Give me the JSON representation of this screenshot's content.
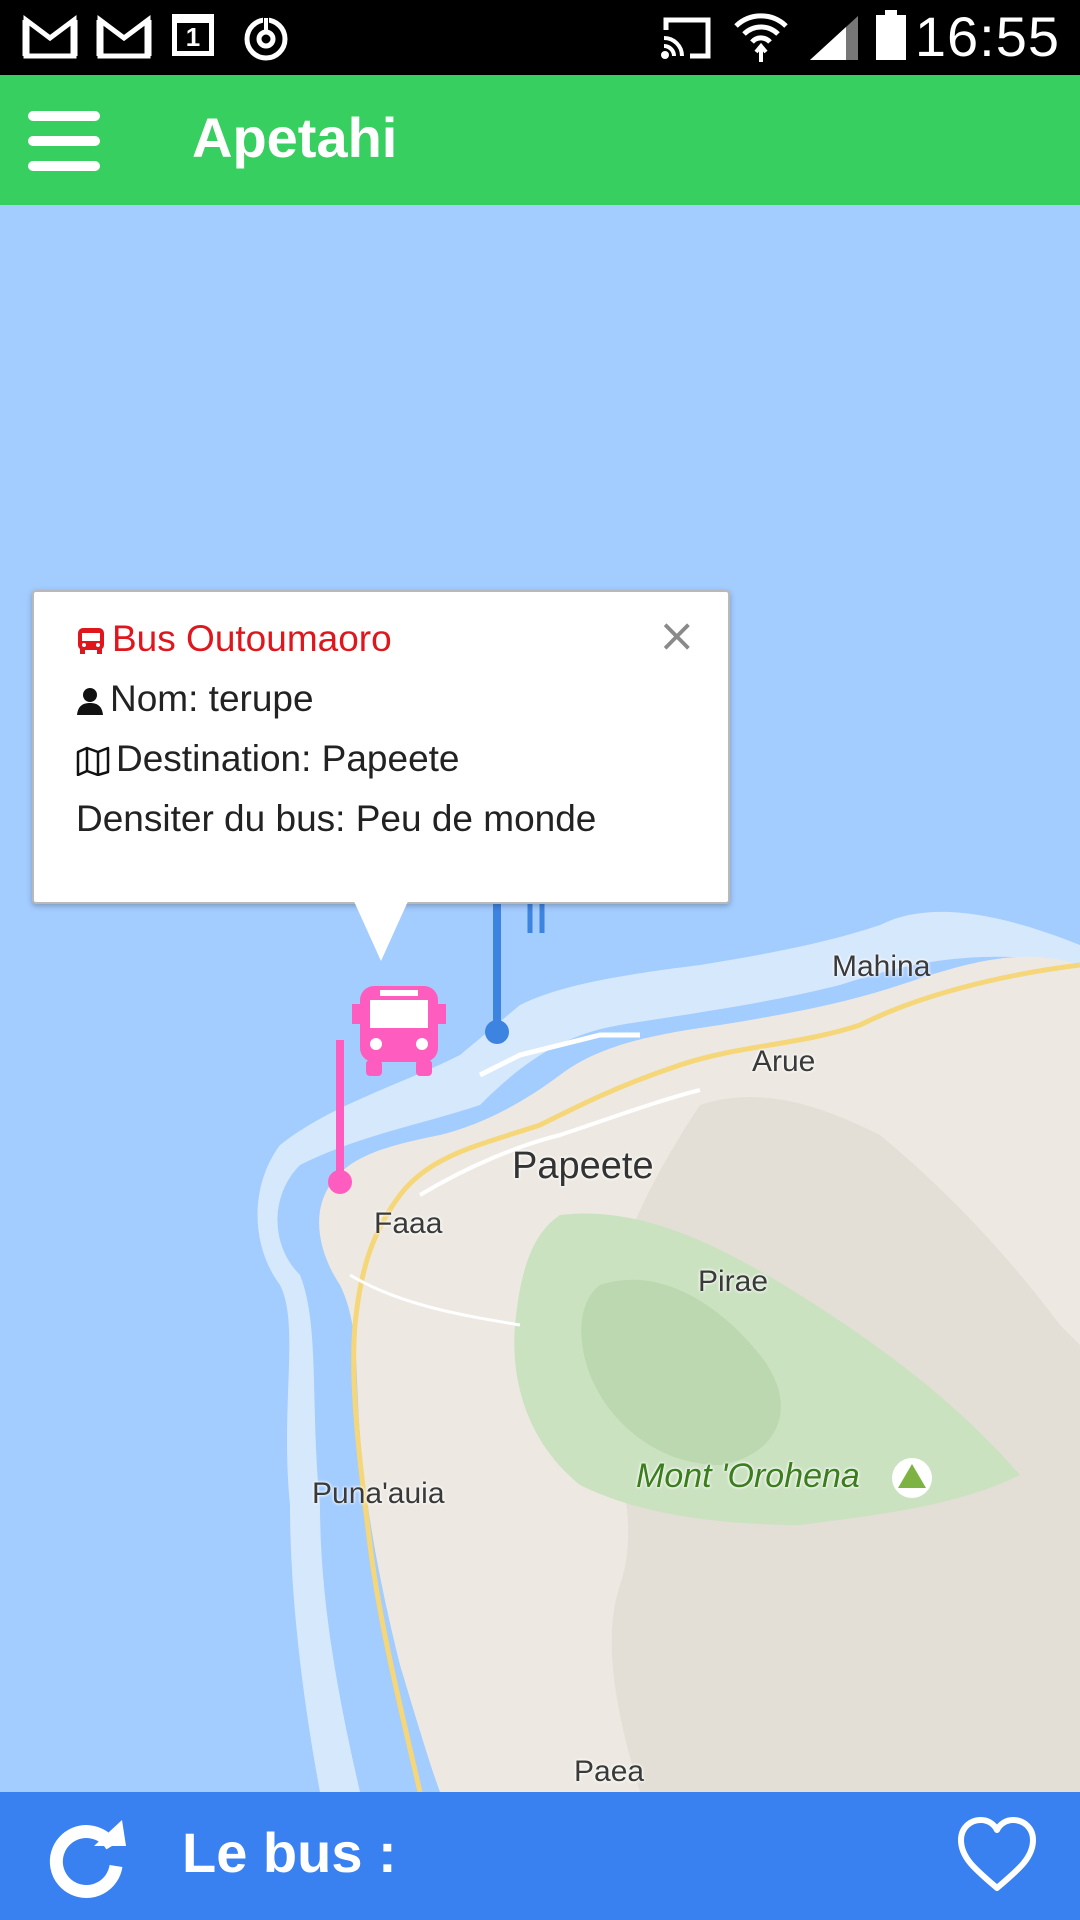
{
  "status_bar": {
    "time": "16:55",
    "left_icons": [
      "gmail-icon",
      "gmail-icon",
      "calendar-icon",
      "sync-icon"
    ],
    "right_icons": [
      "cast-icon",
      "wifi-icon",
      "signal-icon",
      "battery-icon"
    ],
    "calendar_day": "1"
  },
  "app_bar": {
    "title": "Apetahi",
    "background_color": "#38cf61"
  },
  "map": {
    "places": {
      "mahina": "Mahina",
      "arue": "Arue",
      "papeete": "Papeete",
      "faaa": "Faaa",
      "pirae": "Pirae",
      "punaauia": "Puna'auia",
      "orohena": "Mont 'Orohena",
      "paea": "Paea"
    },
    "bus_marker_color": "#ff5cbf"
  },
  "popup": {
    "title": "Bus Outoumaoro",
    "name": "Nom: terupe",
    "destination": "Destination: Papeete",
    "density": "Densiter du bus: Peu de monde",
    "close_symbol": "×",
    "title_color": "#e0161d"
  },
  "bottom_bar": {
    "label": "Le bus :",
    "background_color": "#3980f0"
  }
}
